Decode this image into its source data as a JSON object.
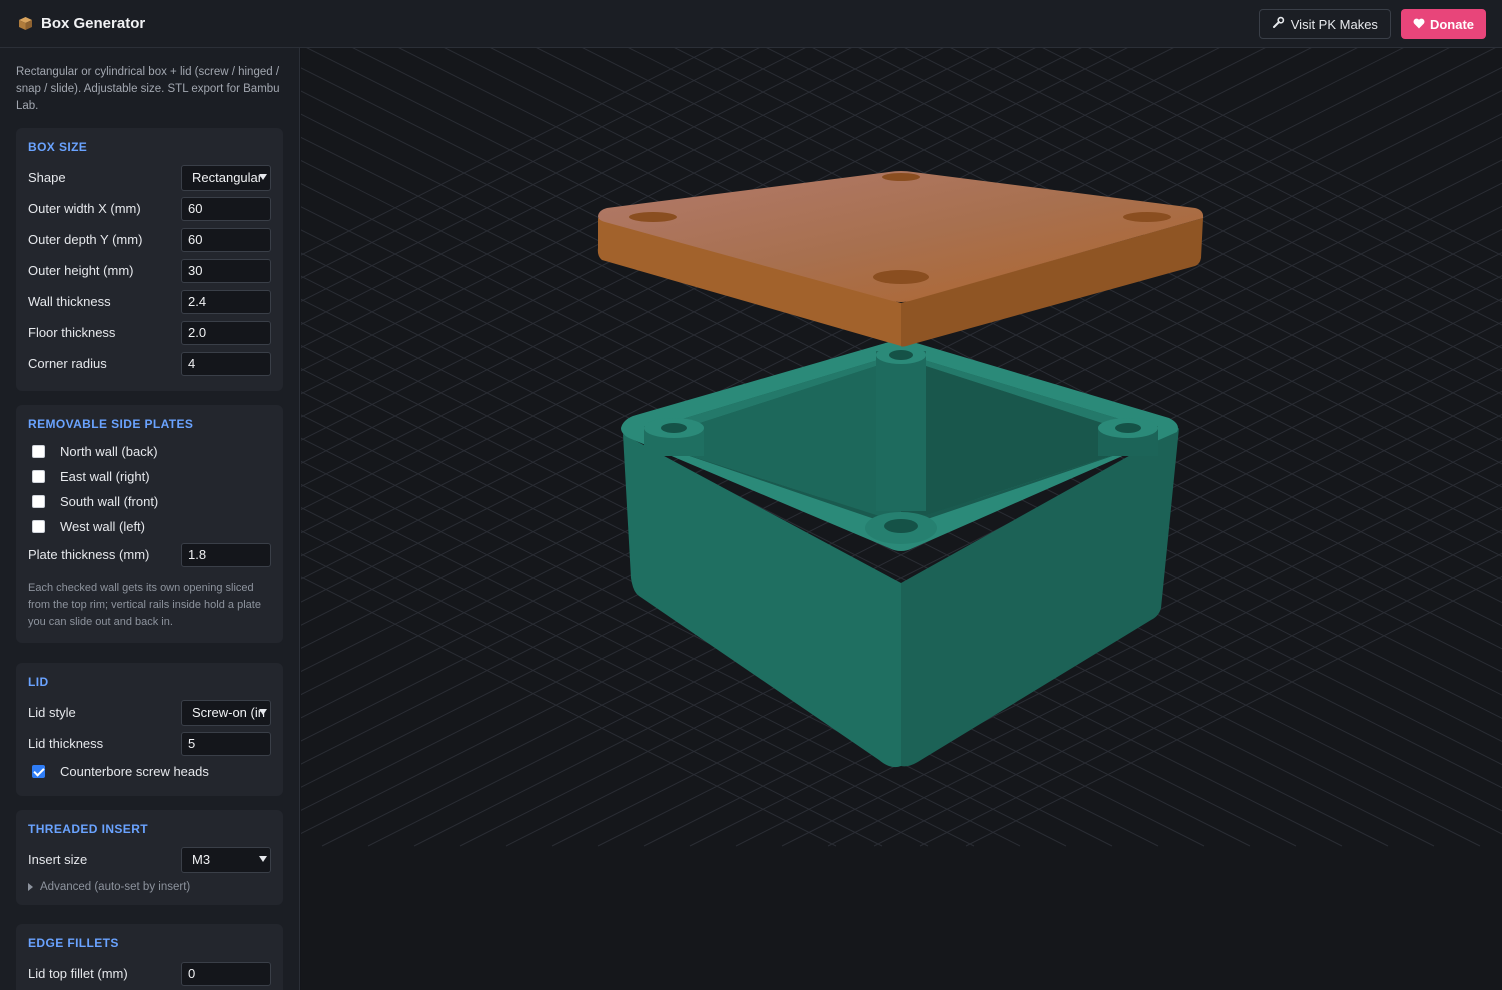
{
  "header": {
    "title": "Box Generator",
    "visit_label": "Visit PK Makes",
    "donate_label": "Donate"
  },
  "sidebar": {
    "intro": "Rectangular or cylindrical box + lid (screw / hinged / snap / slide). Adjustable size. STL export for Bambu Lab.",
    "box_size": {
      "title": "BOX SIZE",
      "shape_label": "Shape",
      "shape_value": "Rectangular",
      "width_label": "Outer width X (mm)",
      "width_value": "60",
      "depth_label": "Outer depth Y (mm)",
      "depth_value": "60",
      "height_label": "Outer height (mm)",
      "height_value": "30",
      "wall_label": "Wall thickness",
      "wall_value": "2.4",
      "floor_label": "Floor thickness",
      "floor_value": "2.0",
      "corner_label": "Corner radius",
      "corner_value": "4"
    },
    "side_plates": {
      "title": "REMOVABLE SIDE PLATES",
      "north": "North wall (back)",
      "east": "East wall (right)",
      "south": "South wall (front)",
      "west": "West wall (left)",
      "plate_label": "Plate thickness (mm)",
      "plate_value": "1.8",
      "note": "Each checked wall gets its own opening sliced from the top rim; vertical rails inside hold a plate you can slide out and back in."
    },
    "lid": {
      "title": "LID",
      "style_label": "Lid style",
      "style_value": "Screw-on (in",
      "thickness_label": "Lid thickness",
      "thickness_value": "5",
      "counterbore_label": "Counterbore screw heads",
      "counterbore_checked": true
    },
    "insert": {
      "title": "THREADED INSERT",
      "size_label": "Insert size",
      "size_value": "M3",
      "advanced_label": "Advanced (auto-set by insert)"
    },
    "fillets": {
      "title": "EDGE FILLETS",
      "lid_top_label": "Lid top fillet (mm)",
      "lid_top_value": "0"
    }
  },
  "viewport": {
    "lid_color": "#b06a3a",
    "box_color": "#1f6b5e",
    "grid_color": "#2c2f36"
  }
}
